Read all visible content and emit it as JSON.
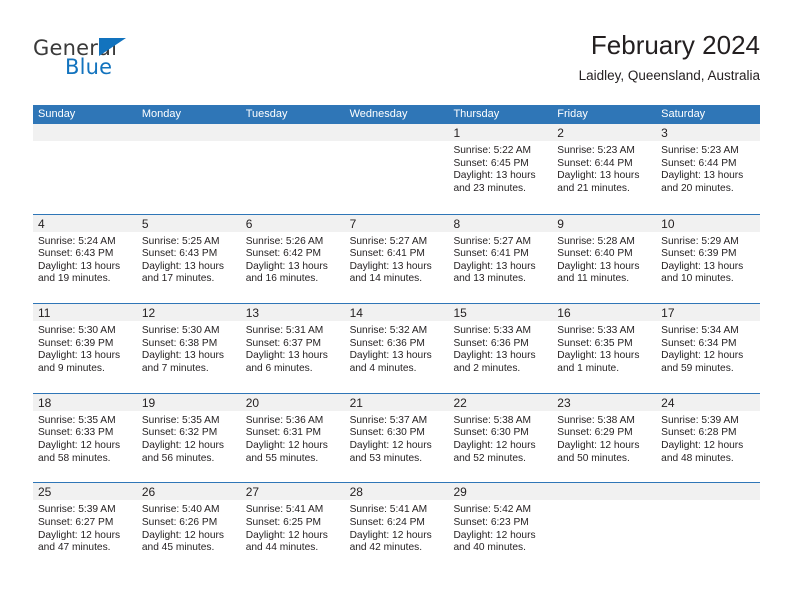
{
  "brand": {
    "name_part1": "General",
    "name_part2": "Blue",
    "color_dark": "#3a3a3a",
    "color_blue": "#1273be"
  },
  "header": {
    "title": "February 2024",
    "subtitle": "Laidley, Queensland, Australia"
  },
  "theme": {
    "header_bar": "#2f76b7",
    "daynum_band": "#f1f1f1",
    "text": "#231f20"
  },
  "weekdays": [
    "Sunday",
    "Monday",
    "Tuesday",
    "Wednesday",
    "Thursday",
    "Friday",
    "Saturday"
  ],
  "weeks": [
    [
      {
        "empty": true
      },
      {
        "empty": true
      },
      {
        "empty": true
      },
      {
        "empty": true
      },
      {
        "day": "1",
        "sunrise": "Sunrise: 5:22 AM",
        "sunset": "Sunset: 6:45 PM",
        "daylight1": "Daylight: 13 hours",
        "daylight2": "and 23 minutes."
      },
      {
        "day": "2",
        "sunrise": "Sunrise: 5:23 AM",
        "sunset": "Sunset: 6:44 PM",
        "daylight1": "Daylight: 13 hours",
        "daylight2": "and 21 minutes."
      },
      {
        "day": "3",
        "sunrise": "Sunrise: 5:23 AM",
        "sunset": "Sunset: 6:44 PM",
        "daylight1": "Daylight: 13 hours",
        "daylight2": "and 20 minutes."
      }
    ],
    [
      {
        "day": "4",
        "sunrise": "Sunrise: 5:24 AM",
        "sunset": "Sunset: 6:43 PM",
        "daylight1": "Daylight: 13 hours",
        "daylight2": "and 19 minutes."
      },
      {
        "day": "5",
        "sunrise": "Sunrise: 5:25 AM",
        "sunset": "Sunset: 6:43 PM",
        "daylight1": "Daylight: 13 hours",
        "daylight2": "and 17 minutes."
      },
      {
        "day": "6",
        "sunrise": "Sunrise: 5:26 AM",
        "sunset": "Sunset: 6:42 PM",
        "daylight1": "Daylight: 13 hours",
        "daylight2": "and 16 minutes."
      },
      {
        "day": "7",
        "sunrise": "Sunrise: 5:27 AM",
        "sunset": "Sunset: 6:41 PM",
        "daylight1": "Daylight: 13 hours",
        "daylight2": "and 14 minutes."
      },
      {
        "day": "8",
        "sunrise": "Sunrise: 5:27 AM",
        "sunset": "Sunset: 6:41 PM",
        "daylight1": "Daylight: 13 hours",
        "daylight2": "and 13 minutes."
      },
      {
        "day": "9",
        "sunrise": "Sunrise: 5:28 AM",
        "sunset": "Sunset: 6:40 PM",
        "daylight1": "Daylight: 13 hours",
        "daylight2": "and 11 minutes."
      },
      {
        "day": "10",
        "sunrise": "Sunrise: 5:29 AM",
        "sunset": "Sunset: 6:39 PM",
        "daylight1": "Daylight: 13 hours",
        "daylight2": "and 10 minutes."
      }
    ],
    [
      {
        "day": "11",
        "sunrise": "Sunrise: 5:30 AM",
        "sunset": "Sunset: 6:39 PM",
        "daylight1": "Daylight: 13 hours",
        "daylight2": "and 9 minutes."
      },
      {
        "day": "12",
        "sunrise": "Sunrise: 5:30 AM",
        "sunset": "Sunset: 6:38 PM",
        "daylight1": "Daylight: 13 hours",
        "daylight2": "and 7 minutes."
      },
      {
        "day": "13",
        "sunrise": "Sunrise: 5:31 AM",
        "sunset": "Sunset: 6:37 PM",
        "daylight1": "Daylight: 13 hours",
        "daylight2": "and 6 minutes."
      },
      {
        "day": "14",
        "sunrise": "Sunrise: 5:32 AM",
        "sunset": "Sunset: 6:36 PM",
        "daylight1": "Daylight: 13 hours",
        "daylight2": "and 4 minutes."
      },
      {
        "day": "15",
        "sunrise": "Sunrise: 5:33 AM",
        "sunset": "Sunset: 6:36 PM",
        "daylight1": "Daylight: 13 hours",
        "daylight2": "and 2 minutes."
      },
      {
        "day": "16",
        "sunrise": "Sunrise: 5:33 AM",
        "sunset": "Sunset: 6:35 PM",
        "daylight1": "Daylight: 13 hours",
        "daylight2": "and 1 minute."
      },
      {
        "day": "17",
        "sunrise": "Sunrise: 5:34 AM",
        "sunset": "Sunset: 6:34 PM",
        "daylight1": "Daylight: 12 hours",
        "daylight2": "and 59 minutes."
      }
    ],
    [
      {
        "day": "18",
        "sunrise": "Sunrise: 5:35 AM",
        "sunset": "Sunset: 6:33 PM",
        "daylight1": "Daylight: 12 hours",
        "daylight2": "and 58 minutes."
      },
      {
        "day": "19",
        "sunrise": "Sunrise: 5:35 AM",
        "sunset": "Sunset: 6:32 PM",
        "daylight1": "Daylight: 12 hours",
        "daylight2": "and 56 minutes."
      },
      {
        "day": "20",
        "sunrise": "Sunrise: 5:36 AM",
        "sunset": "Sunset: 6:31 PM",
        "daylight1": "Daylight: 12 hours",
        "daylight2": "and 55 minutes."
      },
      {
        "day": "21",
        "sunrise": "Sunrise: 5:37 AM",
        "sunset": "Sunset: 6:30 PM",
        "daylight1": "Daylight: 12 hours",
        "daylight2": "and 53 minutes."
      },
      {
        "day": "22",
        "sunrise": "Sunrise: 5:38 AM",
        "sunset": "Sunset: 6:30 PM",
        "daylight1": "Daylight: 12 hours",
        "daylight2": "and 52 minutes."
      },
      {
        "day": "23",
        "sunrise": "Sunrise: 5:38 AM",
        "sunset": "Sunset: 6:29 PM",
        "daylight1": "Daylight: 12 hours",
        "daylight2": "and 50 minutes."
      },
      {
        "day": "24",
        "sunrise": "Sunrise: 5:39 AM",
        "sunset": "Sunset: 6:28 PM",
        "daylight1": "Daylight: 12 hours",
        "daylight2": "and 48 minutes."
      }
    ],
    [
      {
        "day": "25",
        "sunrise": "Sunrise: 5:39 AM",
        "sunset": "Sunset: 6:27 PM",
        "daylight1": "Daylight: 12 hours",
        "daylight2": "and 47 minutes."
      },
      {
        "day": "26",
        "sunrise": "Sunrise: 5:40 AM",
        "sunset": "Sunset: 6:26 PM",
        "daylight1": "Daylight: 12 hours",
        "daylight2": "and 45 minutes."
      },
      {
        "day": "27",
        "sunrise": "Sunrise: 5:41 AM",
        "sunset": "Sunset: 6:25 PM",
        "daylight1": "Daylight: 12 hours",
        "daylight2": "and 44 minutes."
      },
      {
        "day": "28",
        "sunrise": "Sunrise: 5:41 AM",
        "sunset": "Sunset: 6:24 PM",
        "daylight1": "Daylight: 12 hours",
        "daylight2": "and 42 minutes."
      },
      {
        "day": "29",
        "sunrise": "Sunrise: 5:42 AM",
        "sunset": "Sunset: 6:23 PM",
        "daylight1": "Daylight: 12 hours",
        "daylight2": "and 40 minutes."
      },
      {
        "empty": true
      },
      {
        "empty": true
      }
    ]
  ]
}
